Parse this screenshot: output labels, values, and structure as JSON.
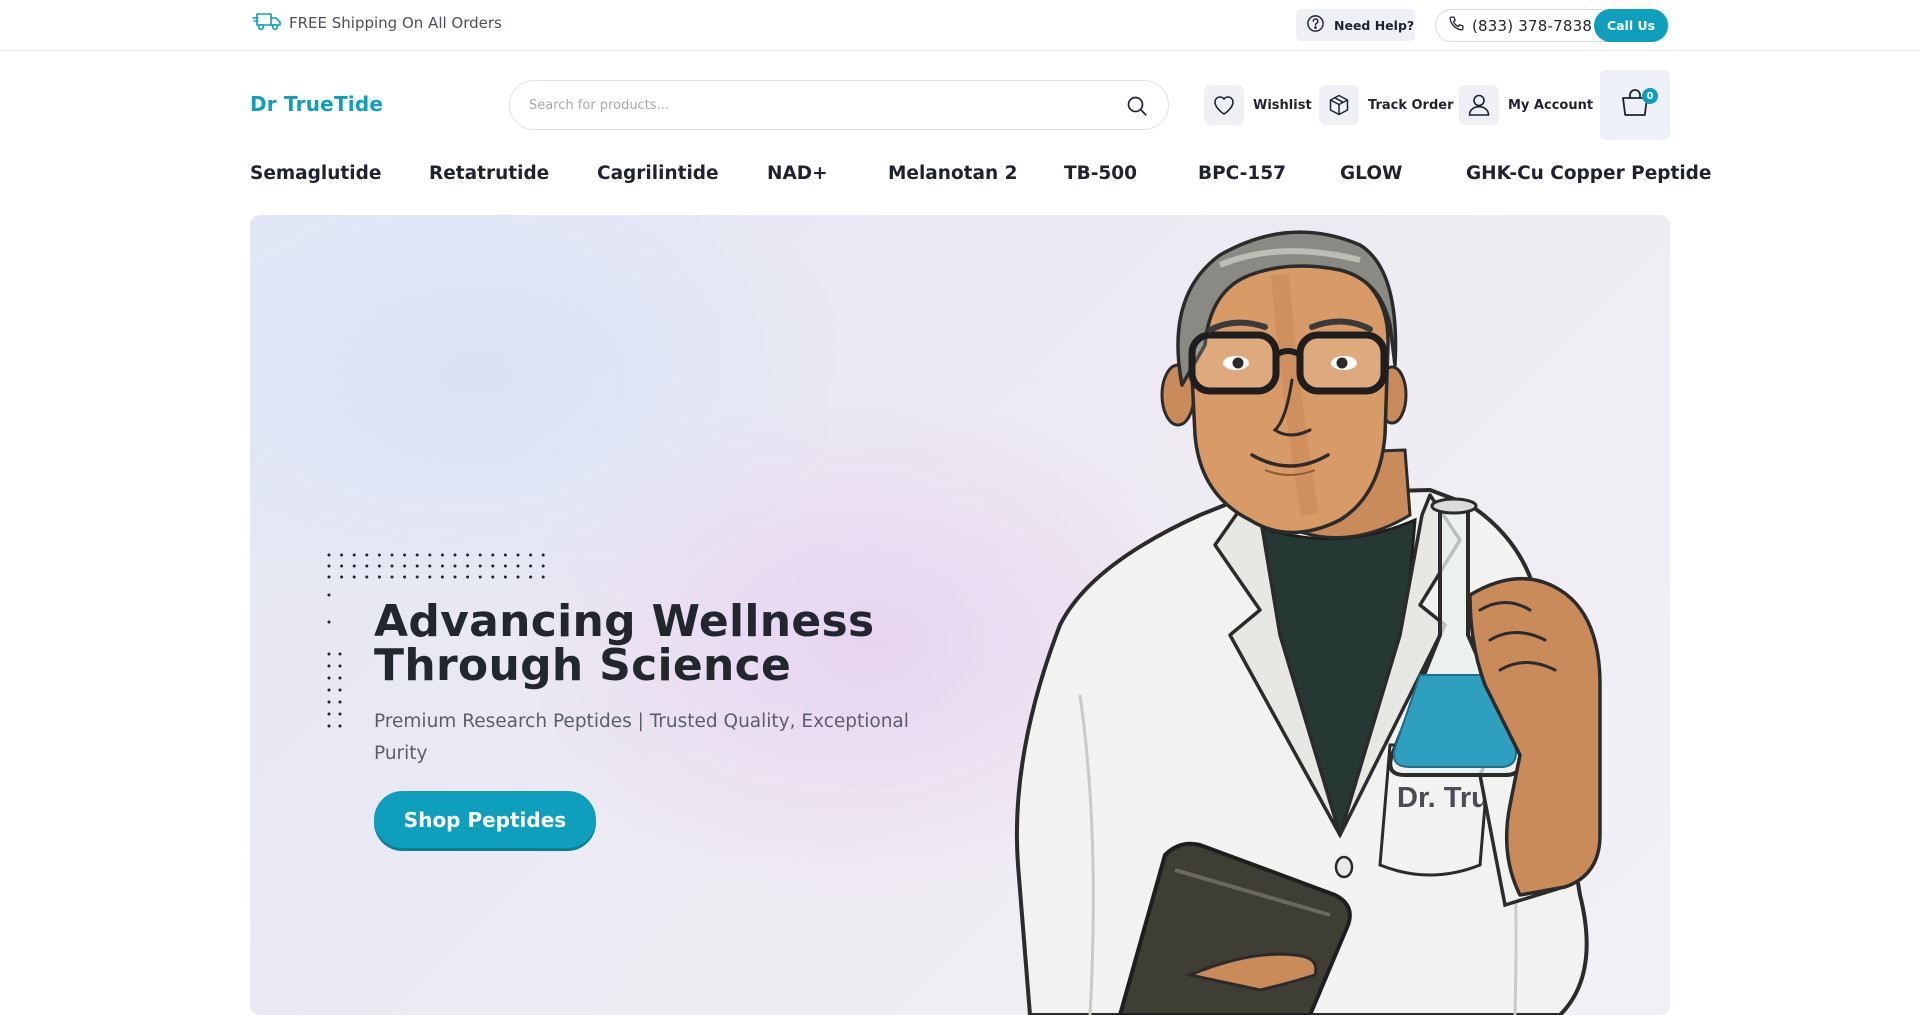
{
  "topbar": {
    "shipping_text": "FREE Shipping On All Orders",
    "help_label": "Need Help?",
    "phone": "(833) 378-7838",
    "call_label": "Call Us"
  },
  "header": {
    "logo": "Dr TrueTide",
    "search_placeholder": "Search for products...",
    "search_value": "",
    "wishlist_label": "Wishlist",
    "track_order_label": "Track Order",
    "account_label": "My Account",
    "cart_count": "0"
  },
  "nav": {
    "categories": [
      "Semaglutide",
      "Retatrutide",
      "Cagrilintide",
      "NAD+",
      "Melanotan 2",
      "TB-500",
      "BPC-157",
      "GLOW",
      "GHK-Cu Copper Peptide"
    ]
  },
  "hero": {
    "title_line1": "Advancing Wellness",
    "title_line2": "Through Science",
    "subtitle": "Premium Research Peptides | Trusted Quality, Exceptional Purity",
    "cta_label": "Shop Peptides",
    "coat_badge": "Dr. True"
  },
  "colors": {
    "accent": "#0d9fbc",
    "text_dark": "#1f2330",
    "icon_bg": "#eef0f6"
  },
  "icons": {
    "shipping": "truck-icon",
    "help": "question-circle-icon",
    "phone": "phone-icon",
    "search": "search-icon",
    "wishlist": "heart-icon",
    "track": "box-icon",
    "account": "user-icon",
    "cart": "shopping-bag-icon"
  }
}
